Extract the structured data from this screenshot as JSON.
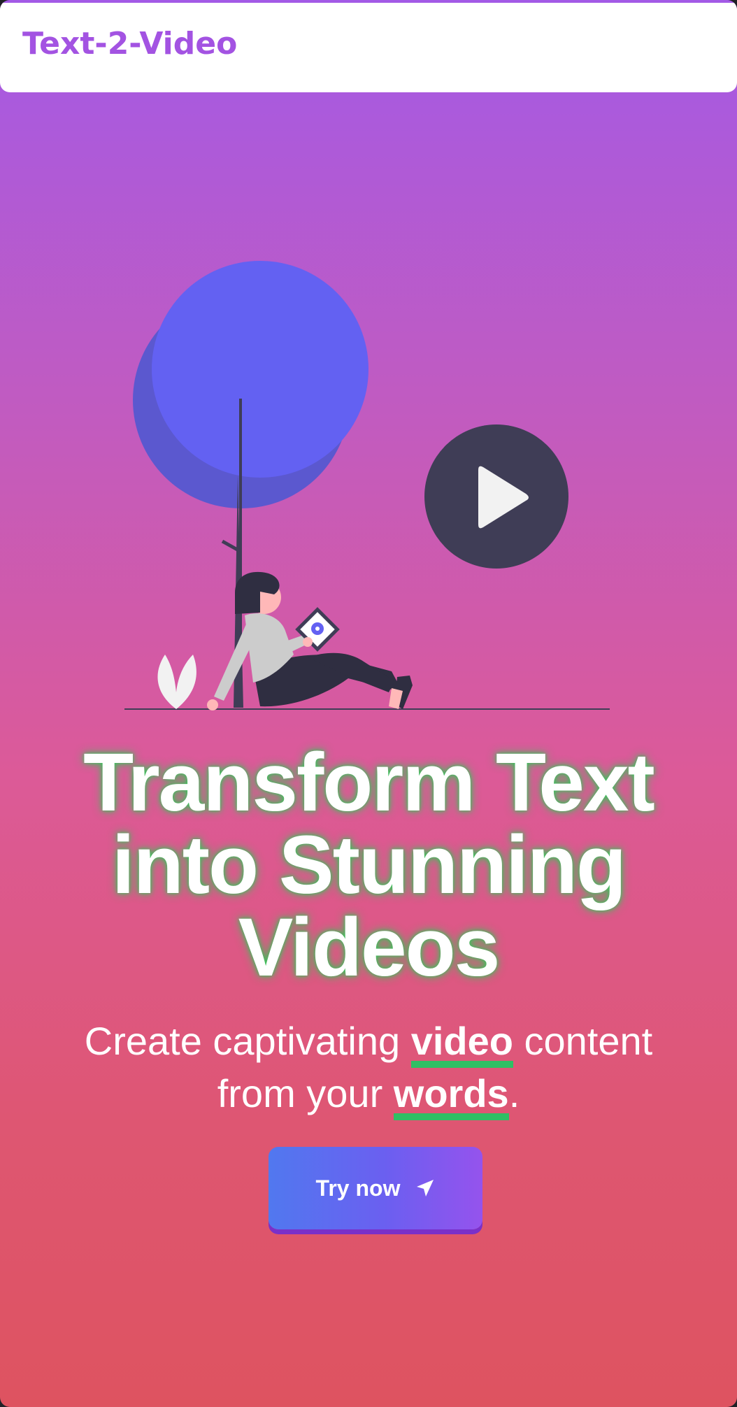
{
  "header": {
    "brand": "Text-2-Video"
  },
  "hero": {
    "title": "Transform Text into Stunning Videos",
    "subtitle_part1": "Create captivating ",
    "subtitle_highlight1": "video",
    "subtitle_part2": " content from your ",
    "subtitle_highlight2": "words",
    "subtitle_part3": "."
  },
  "cta": {
    "label": "Try now",
    "icon": "send-arrow-icon"
  },
  "illustration": {
    "description_icons": [
      "tree-icon",
      "play-icon",
      "person-icon",
      "tablet-icon",
      "plant-icon"
    ]
  },
  "colors": {
    "brand": "#a353e2",
    "gradient_top": "#a35ae6",
    "gradient_bottom": "#de5360",
    "accent_green": "#2fbf64",
    "play_circle": "#3f3d56",
    "tree": "#6361f2"
  }
}
